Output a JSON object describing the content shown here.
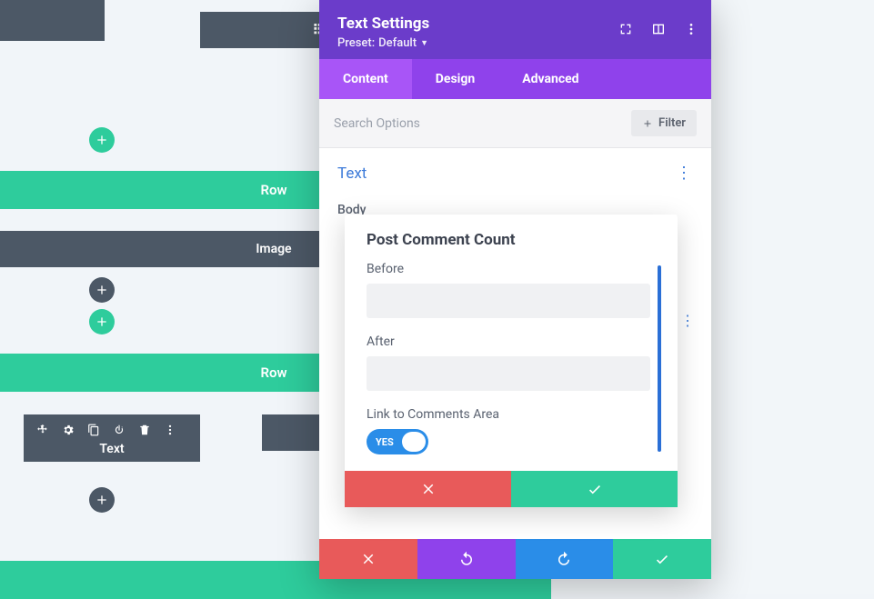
{
  "bg": {
    "row1_label": "Row",
    "row2_label": "Row",
    "image_label": "Image",
    "text_label": "Text",
    "drag_hint": "⠿"
  },
  "modal": {
    "title": "Text Settings",
    "preset_prefix": "Preset: ",
    "preset_value": "Default",
    "tabs": {
      "content": "Content",
      "design": "Design",
      "advanced": "Advanced"
    },
    "search_placeholder": "Search Options",
    "filter_label": "Filter",
    "section_text_title": "Text",
    "body_label": "Body"
  },
  "popover": {
    "title": "Post Comment Count",
    "before_label": "Before",
    "after_label": "After",
    "link_label": "Link to Comments Area",
    "toggle_on": "YES",
    "before_value": "",
    "after_value": ""
  }
}
